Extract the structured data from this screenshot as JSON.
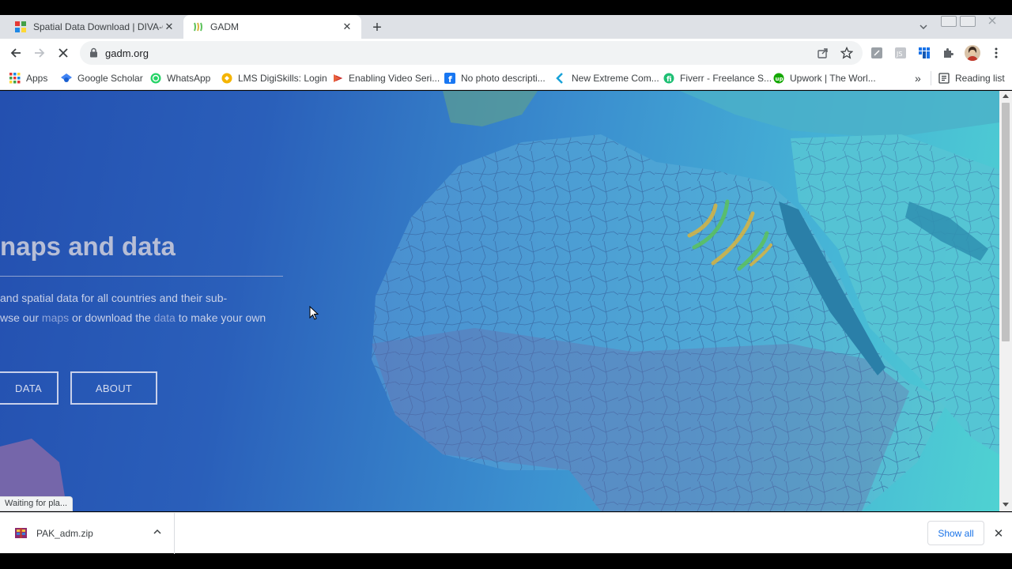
{
  "tabs": [
    {
      "title": "Spatial Data Download | DIVA-GIS",
      "close": "✕"
    },
    {
      "title": "GADM",
      "close": "✕"
    }
  ],
  "new_tab_glyph": "+",
  "address": {
    "url": "gadm.org"
  },
  "bookmarks": [
    {
      "label": "Apps",
      "icon": "apps-grid-icon"
    },
    {
      "label": "Google Scholar",
      "icon": "scholar-icon"
    },
    {
      "label": "WhatsApp",
      "icon": "whatsapp-icon"
    },
    {
      "label": "LMS DigiSkills: Login",
      "icon": "digiskills-icon"
    },
    {
      "label": "Enabling Video Seri...",
      "icon": "video-series-icon"
    },
    {
      "label": "No photo descripti...",
      "icon": "facebook-icon"
    },
    {
      "label": "New Extreme Com...",
      "icon": "kodi-icon"
    },
    {
      "label": "Fiverr - Freelance S...",
      "icon": "fiverr-icon"
    },
    {
      "label": "Upwork | The Worl...",
      "icon": "upwork-icon"
    }
  ],
  "bookmarks_overflow": "»",
  "reading_list": "Reading list",
  "hero": {
    "title": "naps and data",
    "desc_line1": " and spatial data for all countries and their sub-",
    "desc_line2_a": "wse our ",
    "desc_link1": "maps",
    "desc_line2_b": " or download the ",
    "desc_link2": "data",
    "desc_line2_c": " to make your own",
    "btn_data": "DATA",
    "btn_about": "ABOUT"
  },
  "status_text": "Waiting for pla...",
  "download": {
    "filename": "PAK_adm.zip"
  },
  "show_all": "Show all",
  "shelf_close": "✕",
  "colors": {
    "accent_link": "#1a73e8",
    "map_land": "#4a9ed6",
    "logo_yellow": "#d8b440",
    "logo_green": "#5cc25a"
  }
}
